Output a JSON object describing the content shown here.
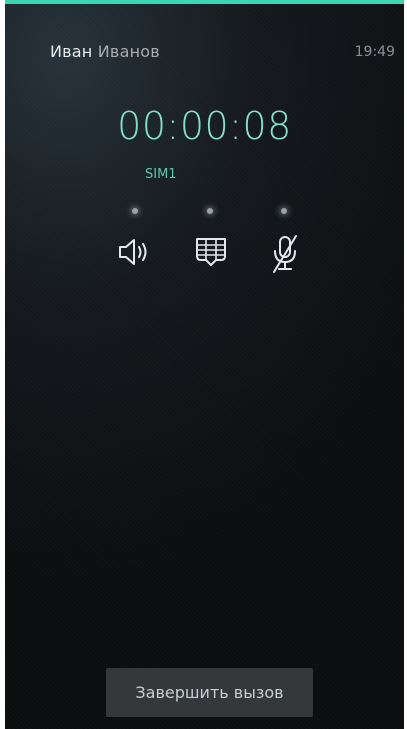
{
  "status_bar": {
    "caller_first_name": "Иван",
    "caller_last_name": "Иванов",
    "time": "19:49"
  },
  "call": {
    "duration": "00:00:08",
    "sim": "SIM1"
  },
  "controls": [
    {
      "name": "speaker",
      "icon": "speaker-icon"
    },
    {
      "name": "keypad",
      "icon": "keypad-icon"
    },
    {
      "name": "mute",
      "icon": "microphone-muted-icon"
    }
  ],
  "end_call": {
    "label": "Завершить вызов"
  },
  "colors": {
    "accent": "#3ad6b4",
    "timer": "#7fe3cd",
    "sim": "#5bc7b0",
    "button_bg": "#34383b"
  }
}
